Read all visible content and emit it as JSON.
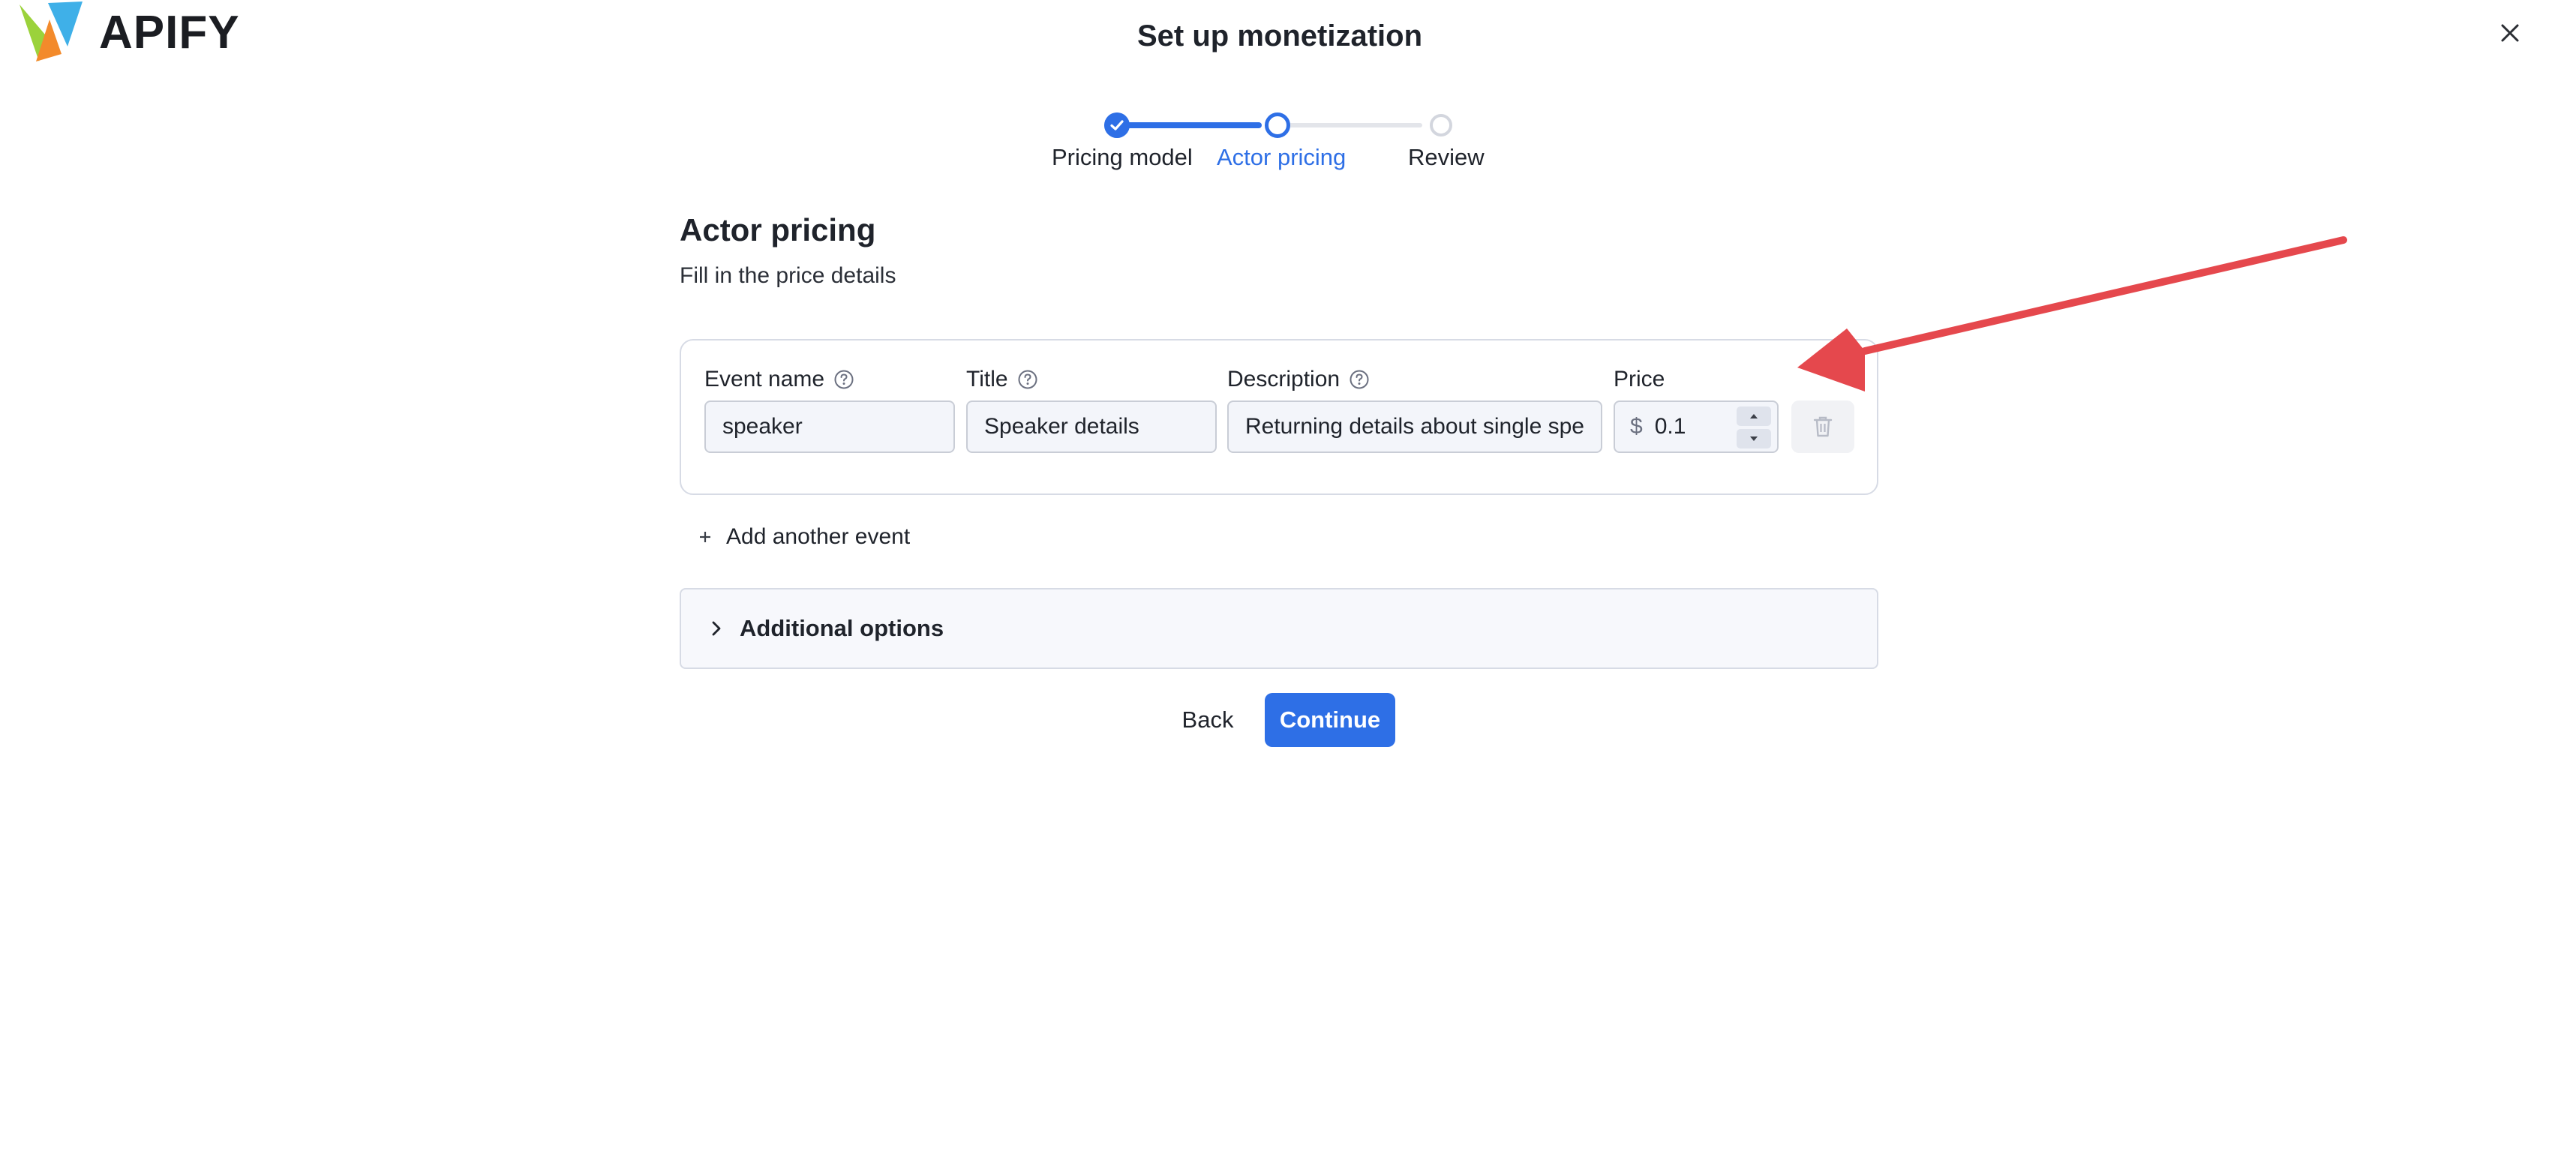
{
  "header": {
    "brand": "APIFY",
    "title": "Set up monetization",
    "close_icon": "close-icon"
  },
  "stepper": {
    "steps": [
      {
        "label": "Pricing model",
        "state": "completed"
      },
      {
        "label": "Actor pricing",
        "state": "active"
      },
      {
        "label": "Review",
        "state": "pending"
      }
    ]
  },
  "section": {
    "title": "Actor pricing",
    "subtitle": "Fill in the price details"
  },
  "event": {
    "event_name_label": "Event name",
    "event_name_value": "speaker",
    "title_label": "Title",
    "title_value": "Speaker details",
    "description_label": "Description",
    "description_value": "Returning details about single spe",
    "price_label": "Price",
    "currency": "$",
    "price_value": "0.1"
  },
  "actions": {
    "add_event": "Add another event",
    "additional_options": "Additional options",
    "back": "Back",
    "continue": "Continue"
  },
  "colors": {
    "accent": "#2e6fe6",
    "annotation_arrow": "#e5484d"
  }
}
